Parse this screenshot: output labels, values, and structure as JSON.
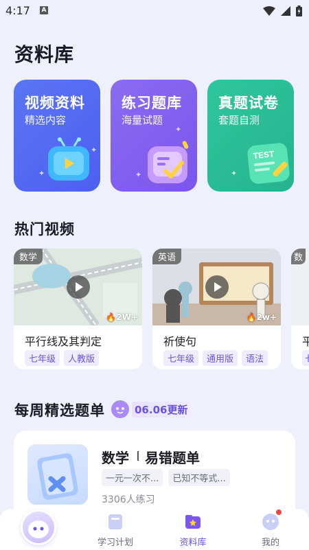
{
  "status_bar": {
    "time": "4:17",
    "notification_letter": "A"
  },
  "page_title": "资料库",
  "categories": [
    {
      "title": "视频资料",
      "subtitle": "精选内容",
      "color": "#4f63f0"
    },
    {
      "title": "练习题库",
      "subtitle": "海量试题",
      "color": "#7b57ee"
    },
    {
      "title": "真题试卷",
      "subtitle": "套题自测",
      "color": "#27b58f",
      "illustration_text": "TEST"
    }
  ],
  "hot_videos": {
    "title": "热门视频",
    "items": [
      {
        "subject": "数学",
        "views": "2W+",
        "title": "平行线及其判定",
        "tags": [
          "七年级",
          "人教版"
        ]
      },
      {
        "subject": "英语",
        "views": "2w+",
        "title": "祈使句",
        "tags": [
          "七年级",
          "通用版",
          "语法"
        ]
      },
      {
        "subject": "数",
        "title": "平",
        "tags": [
          "七"
        ]
      }
    ]
  },
  "weekly": {
    "title": "每周精选题单",
    "badge": "06.06更新",
    "card": {
      "subject": "数学",
      "type": "易错题单",
      "topics": [
        "一元一次不...",
        "已知不等式..."
      ],
      "count": "3306人练习"
    }
  },
  "bottom_nav": {
    "items": [
      {
        "label": "学习计划",
        "icon": "study-plan-icon"
      },
      {
        "label": "资料库",
        "icon": "library-icon",
        "active": true
      },
      {
        "label": "我的",
        "icon": "profile-icon"
      }
    ]
  },
  "colors": {
    "accent": "#6a52e6",
    "background": "#eef0fb"
  }
}
